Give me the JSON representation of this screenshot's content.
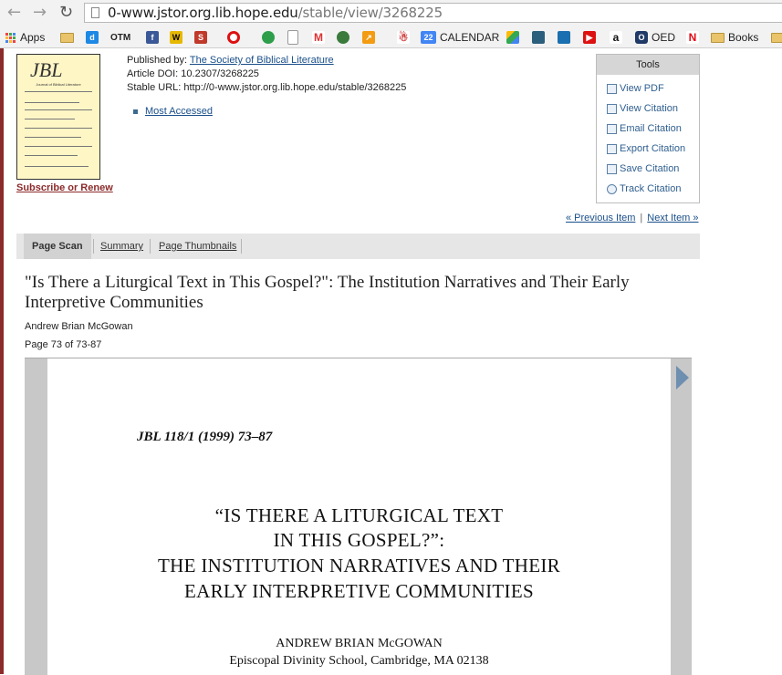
{
  "browser": {
    "url_host": "0-www.jstor.org.lib.hope.edu",
    "url_path": "/stable/view/3268225",
    "bookmarks": {
      "apps": "Apps",
      "otm": "OTM",
      "calendar": "CALENDAR",
      "oed": "OED",
      "books": "Books",
      "calendar_day": "22"
    }
  },
  "journal": {
    "cover_logo": "JBL",
    "cover_subtitle": "Journal of Biblical Literature",
    "subscribe": "Subscribe or Renew"
  },
  "pubinfo": {
    "published_by_label": "Published by: ",
    "publisher": "The Society of Biblical Literature",
    "doi": "Article DOI: 10.2307/3268225",
    "stable_url": "Stable URL: http://0-www.jstor.org.lib.hope.edu/stable/3268225",
    "most_accessed": "Most Accessed"
  },
  "tools": {
    "header": "Tools",
    "items": [
      "View PDF",
      "View Citation",
      "Email Citation",
      "Export Citation",
      "Save Citation",
      "Track Citation"
    ]
  },
  "nav": {
    "previous": "«  Previous Item",
    "separator": "|",
    "next": "Next Item  »"
  },
  "tabs": [
    "Page Scan",
    "Summary",
    "Page Thumbnails"
  ],
  "article": {
    "title": "\"Is There a Liturgical Text in This Gospel?\": The Institution Narratives and Their Early Interpretive Communities",
    "author": "Andrew Brian McGowan",
    "page": "Page 73 of 73-87"
  },
  "scan": {
    "citation": "JBL 118/1 (1999) 73–87",
    "title_lines": [
      "“IS THERE A LITURGICAL TEXT",
      "IN THIS GOSPEL?”:",
      "THE INSTITUTION NARRATIVES AND THEIR",
      "EARLY INTERPRETIVE COMMUNITIES"
    ],
    "author": "ANDREW BRIAN McGOWAN",
    "affiliation": "Episcopal Divinity School, Cambridge, MA 02138"
  }
}
